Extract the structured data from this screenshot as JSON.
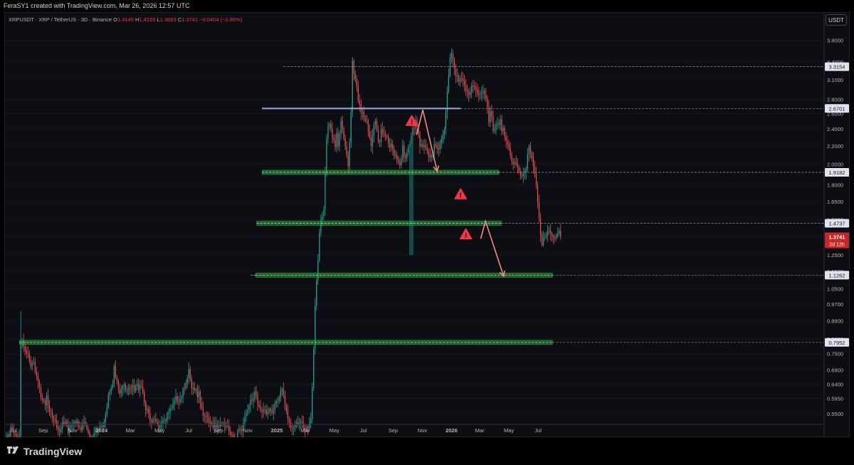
{
  "header": {
    "credit": "FeraSY1 created with TradingView.com, Mar 26, 2026 12:57 UTC"
  },
  "legend": {
    "symbol": "XRPUSDT · XRP / TetherUS · 3D · Binance",
    "o_label": "O",
    "o": "1.4145",
    "h_label": "H",
    "h": "1.4165",
    "l_label": "L",
    "l": "1.3683",
    "c_label": "C",
    "c": "1.3741",
    "change": "−0.0404 (−2.86%)"
  },
  "currency_button": "USDT",
  "brand": {
    "name": "TradingView",
    "logo_icon": "tradingview-logo-icon"
  },
  "colors": {
    "up": "#26a69a",
    "down": "#ef5350",
    "level": "#1b7a2b",
    "arrow": "#f28b82",
    "price_tag": "#c62828"
  },
  "chart_data": {
    "type": "candlestick",
    "scale": "log",
    "ylim": [
      0.52,
      4.1
    ],
    "y_ticks": [
      "3.8000",
      "3.4000",
      "3.1000",
      "2.8000",
      "2.6000",
      "2.4000",
      "2.2000",
      "2.0000",
      "1.8000",
      "1.6500",
      "1.5000",
      "1.3750",
      "1.2500",
      "1.1500",
      "1.0500",
      "0.9700",
      "0.8900",
      "0.8100",
      "0.7500",
      "0.6900",
      "0.6400",
      "0.5950",
      "0.5500"
    ],
    "x_ticks": [
      "Jul",
      "Sep",
      "Nov",
      "2024",
      "Mar",
      "May",
      "Jul",
      "Sep",
      "Nov",
      "2025",
      "Mar",
      "May",
      "Jul",
      "Sep",
      "Nov",
      "2026",
      "Mar",
      "May",
      "Jul"
    ],
    "price_flags": [
      "3.3154",
      "2.6701",
      "1.9182",
      "1.4737",
      "1.1262",
      "0.7952"
    ],
    "current_price": {
      "value": "1.3741",
      "countdown": "2d 12h"
    },
    "support_zones": [
      {
        "price": 0.7952,
        "from": "2023-07-13",
        "to": "2026-07-31"
      },
      {
        "price": 1.1262,
        "from": "2024-11-18",
        "to": "2026-07-31"
      },
      {
        "price": 1.4737,
        "from": "2024-11-20",
        "to": "2026-04-15"
      },
      {
        "price": 1.9182,
        "from": "2024-12-01",
        "to": "2026-04-10"
      }
    ],
    "resistance_line": {
      "price": 2.6701,
      "from": "2024-12-01",
      "to": "2026-01-20"
    },
    "dashed_line": {
      "price": 3.3154,
      "from": "2025-01-15",
      "to": "2026-07-31"
    },
    "warnings": [
      {
        "date": "2025-10-10",
        "price": 2.5
      },
      {
        "date": "2026-01-20",
        "price": 1.71
      },
      {
        "date": "2026-01-31",
        "price": 1.39
      }
    ],
    "arrows": [
      [
        [
          "2025-10-20",
          2.33
        ],
        [
          "2025-11-02",
          2.65
        ],
        [
          "2025-12-02",
          1.93
        ]
      ],
      [
        [
          "2026-03-03",
          1.36
        ],
        [
          "2026-03-13",
          1.49
        ],
        [
          "2026-04-20",
          1.12
        ]
      ]
    ],
    "start": "2023-06-13",
    "interval_days": 3,
    "closes": [
      0.4728,
      0.4829,
      0.4934,
      0.4899,
      0.5124,
      0.5085,
      0.4973,
      0.4954,
      0.4883,
      0.4812,
      0.4886,
      0.7842,
      0.8018,
      0.7788,
      0.7626,
      0.7518,
      0.7489,
      0.7214,
      0.7025,
      0.7138,
      0.7172,
      0.6831,
      0.6682,
      0.6502,
      0.6302,
      0.5985,
      0.5911,
      0.5888,
      0.5738,
      0.6031,
      0.574,
      0.5559,
      0.5542,
      0.5372,
      0.5332,
      0.5297,
      0.5127,
      0.5054,
      0.5005,
      0.5088,
      0.5264,
      0.5214,
      0.5264,
      0.5209,
      0.4978,
      0.5123,
      0.5174,
      0.5217,
      0.5269,
      0.5236,
      0.5286,
      0.5128,
      0.5124,
      0.5043,
      0.5242,
      0.5276,
      0.5186,
      0.5081,
      0.4989,
      0.4866,
      0.4815,
      0.4876,
      0.4973,
      0.5103,
      0.4987,
      0.5068,
      0.5158,
      0.5168,
      0.5125,
      0.5255,
      0.5458,
      0.5681,
      0.6071,
      0.6182,
      0.6289,
      0.6401,
      0.7045,
      0.6636,
      0.6512,
      0.6242,
      0.6096,
      0.6245,
      0.6334,
      0.6393,
      0.6208,
      0.6221,
      0.6284,
      0.6272,
      0.6269,
      0.6367,
      0.6175,
      0.6337,
      0.6412,
      0.6214,
      0.6349,
      0.6328,
      0.615,
      0.5848,
      0.5594,
      0.5635,
      0.5506,
      0.5315,
      0.5264,
      0.5331,
      0.5335,
      0.5281,
      0.5203,
      0.5093,
      0.5155,
      0.5241,
      0.532,
      0.5332,
      0.5296,
      0.5507,
      0.5531,
      0.5633,
      0.5655,
      0.5757,
      0.5877,
      0.6024,
      0.5846,
      0.5837,
      0.5936,
      0.5996,
      0.6263,
      0.6252,
      0.6438,
      0.6624,
      0.6928,
      0.6573,
      0.6264,
      0.6284,
      0.6202,
      0.6239,
      0.5996,
      0.6164,
      0.5799,
      0.5669,
      0.5436,
      0.5443,
      0.5395,
      0.5375,
      0.5245,
      0.5185,
      0.5251,
      0.5113,
      0.5231,
      0.5113,
      0.5194,
      0.5154,
      0.5221,
      0.5232,
      0.5229,
      0.5156,
      0.5158,
      0.5152,
      0.5025,
      0.4934,
      0.4928,
      0.4809,
      0.4702,
      0.4725,
      0.5028,
      0.5087,
      0.5079,
      0.5025,
      0.5233,
      0.5417,
      0.5503,
      0.5606,
      0.5748,
      0.5911,
      0.5877,
      0.5963,
      0.6176,
      0.6087,
      0.577,
      0.5698,
      0.5589,
      0.5544,
      0.5615,
      0.5604,
      0.5484,
      0.5553,
      0.5633,
      0.5573,
      0.552,
      0.5634,
      0.5774,
      0.5864,
      0.5859,
      0.5972,
      0.6184,
      0.6233,
      0.6034,
      0.5722,
      0.5591,
      0.5357,
      0.5252,
      0.5103,
      0.5098,
      0.5115,
      0.5182,
      0.5252,
      0.5209,
      0.5246,
      0.5269,
      0.5231,
      0.5103,
      0.5062,
      0.5132,
      0.5089,
      0.5233,
      0.536,
      0.6289,
      0.7689,
      0.9618,
      1.0965,
      1.2151,
      1.4049,
      1.502,
      1.5287,
      1.5838,
      1.9205,
      2.2853,
      2.4358,
      2.4612,
      2.4054,
      2.2905,
      2.2649,
      2.1832,
      2.353,
      2.1957,
      2.3356,
      2.5062,
      2.3997,
      2.2855,
      2.1931,
      2.1037,
      1.9806,
      2.2306,
      2.6155,
      3.4121,
      3.1931,
      3.1085,
      2.9922,
      2.7743,
      2.7339,
      2.6102,
      2.6225,
      2.5364,
      2.5135,
      2.5107,
      2.3689,
      2.2932,
      2.1939,
      2.3232,
      2.4506,
      2.503,
      2.3829,
      2.2575,
      2.246,
      2.4037,
      2.3536,
      2.3349,
      2.3125,
      2.3112,
      2.2307,
      2.1809,
      2.2236,
      2.166,
      2.0923,
      2.1029,
      2.0413,
      2.0226,
      1.9893,
      2.0549,
      2.2027,
      2.0915,
      2.0657,
      2.1232,
      2.194,
      2.2217,
      2.3205,
      2.4119,
      2.4087,
      2.5143,
      2.4325,
      2.3322,
      2.1971,
      2.2158,
      2.1866,
      2.2069,
      2.1767,
      2.1416,
      2.0939,
      2.0715,
      2.1007,
      2.1151,
      2.2229,
      2.2103,
      2.1732,
      2.1605,
      2.2263,
      2.2712,
      2.3201,
      2.397,
      2.6231,
      2.9111,
      3.1707,
      3.4862,
      3.5466,
      3.4218,
      3.2771,
      3.1562,
      3.171,
      3.0659,
      3.1262,
      3.1101,
      3.0787,
      3.0016,
      2.9342,
      2.9116,
      2.8627,
      2.9061,
      3.0079,
      2.9948,
      2.9788,
      2.9416,
      2.8843,
      2.8684,
      2.8745,
      2.9045,
      2.9218,
      2.8648,
      2.8081,
      2.6864,
      2.4838,
      2.6301,
      2.5569,
      2.3791,
      2.3982,
      2.4613,
      2.4735,
      2.4585,
      2.5235,
      2.3709,
      2.4168,
      2.3061,
      2.258,
      2.2245,
      2.1734,
      2.0953,
      2.0276,
      2.0065,
      2.0222,
      2.0036,
      1.9679,
      1.9297,
      1.8894,
      1.8799,
      1.9051,
      1.9184,
      1.9614,
      2.1032,
      2.1961,
      2.1206,
      2.0596,
      1.9773,
      1.9045,
      1.7952,
      1.6486,
      1.5142,
      1.3882,
      1.3175,
      1.3681,
      1.3742,
      1.3829,
      1.4124,
      1.4171,
      1.3984,
      1.3782,
      1.3676,
      1.3667,
      1.3836,
      1.3976,
      1.4145,
      1.3741
    ]
  }
}
